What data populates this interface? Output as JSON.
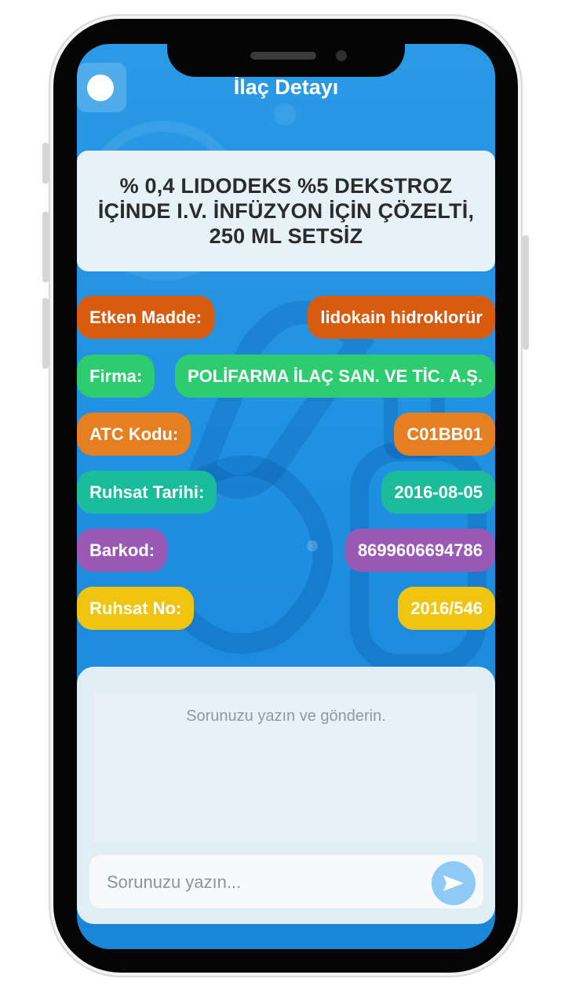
{
  "header": {
    "title": "İlaç Detayı"
  },
  "drug": {
    "name": "% 0,4 LIDODEKS %5 DEKSTROZ İÇİNDE I.V. İNFÜZYON İÇİN ÇÖZELTİ, 250 ML SETSİZ"
  },
  "fields": [
    {
      "label": "Etken Madde:",
      "value": "lidokain hidroklorür",
      "color": "#d95b0e"
    },
    {
      "label": "Firma:",
      "value": "POLİFARMA İLAÇ SAN. VE TİC. A.Ş.",
      "color": "#2ecc71"
    },
    {
      "label": "ATC Kodu:",
      "value": "C01BB01",
      "color": "#e67e22"
    },
    {
      "label": "Ruhsat Tarihi:",
      "value": "2016-08-05",
      "color": "#1abc9c"
    },
    {
      "label": "Barkod:",
      "value": "8699606694786",
      "color": "#9b59b6"
    },
    {
      "label": "Ruhsat No:",
      "value": "2016/546",
      "color": "#f1c40f"
    }
  ],
  "chat": {
    "hint": "Sorunuzu yazın ve gönderin.",
    "placeholder": "Sorunuzu yazın...",
    "send_icon": "send-icon"
  }
}
